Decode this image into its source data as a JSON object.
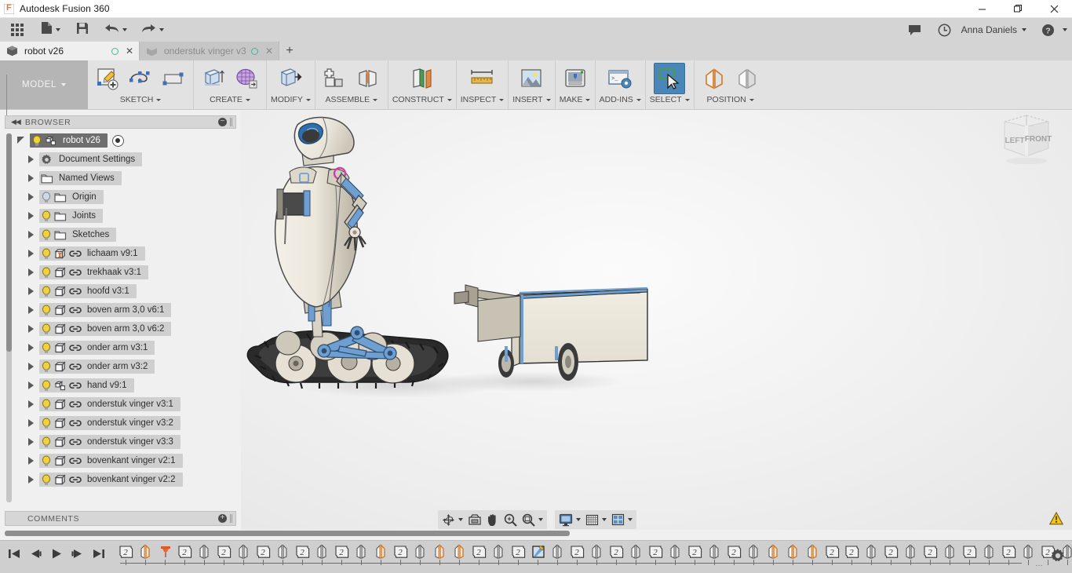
{
  "window": {
    "title": "Autodesk Fusion 360",
    "logo_icon": "fusion-logo-icon",
    "minimize_label": "—",
    "maximize_label": "❐",
    "close_label": "✕"
  },
  "quick_access": {
    "app_grid_icon": "app-grid-icon",
    "new_file_icon": "new-file-icon",
    "save_icon": "save-icon",
    "undo_icon": "undo-icon",
    "redo_icon": "redo-icon",
    "comments_icon": "comments-icon",
    "history_icon": "history-icon",
    "user_name": "Anna Daniels",
    "help_icon": "help-icon"
  },
  "tabs": [
    {
      "label": "robot v26",
      "active": true,
      "dot_icon": "sync-circle-icon",
      "close_icon": "close-icon",
      "doc_icon": "document-cube-icon"
    },
    {
      "label": "onderstuk vinger v3",
      "active": false,
      "dot_icon": "sync-circle-icon",
      "close_icon": "close-icon",
      "doc_icon": "document-cube-icon"
    }
  ],
  "tab_add_label": "+",
  "ribbon": {
    "workspace": "MODEL",
    "groups": [
      {
        "label": "SKETCH",
        "icons": [
          "create-sketch-icon",
          "spline-icon",
          "rectangle-icon"
        ]
      },
      {
        "label": "CREATE",
        "icons": [
          "extrude-icon",
          "create-form-icon"
        ]
      },
      {
        "label": "MODIFY",
        "icons": [
          "press-pull-icon"
        ]
      },
      {
        "label": "ASSEMBLE",
        "icons": [
          "new-component-icon",
          "joint-icon"
        ]
      },
      {
        "label": "CONSTRUCT",
        "icons": [
          "offset-plane-icon"
        ]
      },
      {
        "label": "INSPECT",
        "icons": [
          "measure-icon"
        ]
      },
      {
        "label": "INSERT",
        "icons": [
          "insert-image-icon"
        ]
      },
      {
        "label": "MAKE",
        "icons": [
          "3d-print-icon"
        ]
      },
      {
        "label": "ADD-INS",
        "icons": [
          "scripts-addins-icon"
        ]
      },
      {
        "label": "SELECT",
        "icons": [
          "select-window-icon"
        ],
        "active": true
      },
      {
        "label": "POSITION",
        "icons": [
          "position-active-icon",
          "position-inactive-icon"
        ]
      }
    ]
  },
  "browser": {
    "header_title": "BROWSER",
    "collapse_icon": "collapse-left-icon",
    "minimize_icon": "minimize-icon",
    "tree": [
      {
        "label": "robot v26",
        "depth": 0,
        "icon": "component-icon",
        "bulb": "on",
        "link": false,
        "radio": true
      },
      {
        "label": "Document Settings",
        "depth": 1,
        "icon": "gear-icon",
        "bulb": "none",
        "link": false
      },
      {
        "label": "Named Views",
        "depth": 1,
        "icon": "folder-icon",
        "bulb": "none",
        "link": false
      },
      {
        "label": "Origin",
        "depth": 1,
        "icon": "folder-icon",
        "bulb": "off",
        "link": false
      },
      {
        "label": "Joints",
        "depth": 1,
        "icon": "folder-icon",
        "bulb": "on",
        "link": false
      },
      {
        "label": "Sketches",
        "depth": 1,
        "icon": "folder-icon",
        "bulb": "on",
        "link": false
      },
      {
        "label": "lichaam v9:1",
        "depth": 1,
        "icon": "body-locked-icon",
        "bulb": "on",
        "link": true
      },
      {
        "label": "trekhaak v3:1",
        "depth": 1,
        "icon": "body-icon",
        "bulb": "on",
        "link": true
      },
      {
        "label": "hoofd v3:1",
        "depth": 1,
        "icon": "body-icon",
        "bulb": "on",
        "link": true
      },
      {
        "label": "boven arm 3,0 v6:1",
        "depth": 1,
        "icon": "body-icon",
        "bulb": "on",
        "link": true
      },
      {
        "label": "boven arm 3,0 v6:2",
        "depth": 1,
        "icon": "body-icon",
        "bulb": "on",
        "link": true
      },
      {
        "label": "onder arm v3:1",
        "depth": 1,
        "icon": "body-icon",
        "bulb": "on",
        "link": true
      },
      {
        "label": "onder arm v3:2",
        "depth": 1,
        "icon": "body-icon",
        "bulb": "on",
        "link": true
      },
      {
        "label": "hand v9:1",
        "depth": 1,
        "icon": "component-icon",
        "bulb": "on",
        "link": true
      },
      {
        "label": "onderstuk vinger v3:1",
        "depth": 1,
        "icon": "body-icon",
        "bulb": "on",
        "link": true
      },
      {
        "label": "onderstuk vinger v3:2",
        "depth": 1,
        "icon": "body-icon",
        "bulb": "on",
        "link": true
      },
      {
        "label": "onderstuk vinger v3:3",
        "depth": 1,
        "icon": "body-icon",
        "bulb": "on",
        "link": true
      },
      {
        "label": "bovenkant vinger v2:1",
        "depth": 1,
        "icon": "body-icon",
        "bulb": "on",
        "link": true
      },
      {
        "label": "bovenkant vinger v2:2",
        "depth": 1,
        "icon": "body-icon",
        "bulb": "on",
        "link": true
      }
    ]
  },
  "comments": {
    "title": "COMMENTS",
    "add_icon": "add-comment-icon"
  },
  "canvas": {
    "view_cube": {
      "face_left": "LEFT",
      "face_front": "FRONT"
    },
    "model_description": "robot with tracked base and trailer"
  },
  "navbar": {
    "orbit_icon": "orbit-icon",
    "look_at_icon": "look-at-icon",
    "pan_icon": "pan-hand-icon",
    "zoom_icon": "zoom-icon",
    "fit_icon": "zoom-fit-icon",
    "display_settings_icon": "display-settings-icon",
    "grid_snaps_icon": "grid-snaps-icon",
    "viewports_icon": "viewports-icon"
  },
  "status": {
    "warning_icon": "warning-triangle-icon"
  },
  "timeline": {
    "playback": [
      "go-to-beginning-icon",
      "step-back-icon",
      "play-icon",
      "step-forward-icon",
      "go-to-end-icon"
    ],
    "settings_icon": "timeline-settings-icon",
    "overflow_label": "…",
    "features": [
      "joint-icon",
      "component-icon",
      "marker-icon",
      "joint-icon",
      "rigid-group-icon",
      "joint-icon",
      "rigid-group-icon",
      "joint-icon",
      "rigid-group-icon",
      "joint-icon",
      "rigid-group-icon",
      "joint-icon",
      "rigid-group-icon",
      "component-icon",
      "joint-icon",
      "rigid-group-icon",
      "component-icon",
      "component-icon",
      "joint-icon",
      "rigid-group-icon",
      "joint-icon",
      "sketch-icon",
      "rigid-group-icon",
      "joint-icon",
      "rigid-group-icon",
      "joint-icon",
      "rigid-group-icon",
      "joint-icon",
      "rigid-group-icon",
      "joint-icon",
      "rigid-group-icon",
      "joint-icon",
      "rigid-group-icon",
      "component-icon",
      "component-icon",
      "component-icon",
      "joint-icon",
      "joint-icon",
      "rigid-group-icon",
      "joint-icon",
      "rigid-group-icon",
      "joint-icon",
      "rigid-group-icon",
      "joint-icon",
      "rigid-group-icon",
      "joint-icon",
      "rigid-group-icon",
      "joint-icon",
      "rigid-group-icon"
    ]
  },
  "colors": {
    "accent_blue": "#4a86b8",
    "ribbon_bg": "#e2e2e2",
    "panel_bg": "#f0f0f0",
    "titlebar_bg": "#ffffff",
    "warning_yellow": "#f5c518",
    "tab_sync_green": "#49b39b",
    "model_blue": "#6f9fd0"
  }
}
